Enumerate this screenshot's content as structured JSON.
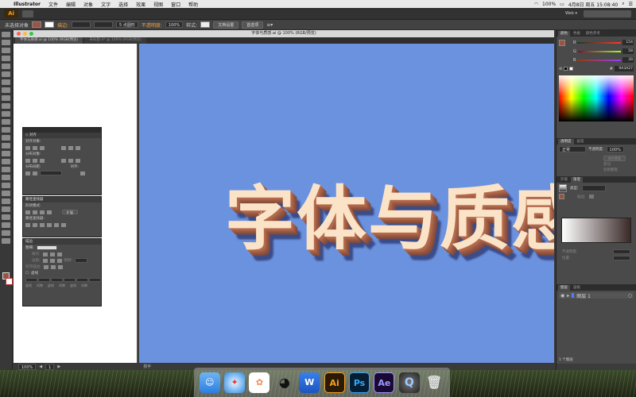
{
  "menubar": {
    "apple": "",
    "items": [
      "Illustrator",
      "文件",
      "编辑",
      "对象",
      "文字",
      "选择",
      "效果",
      "视图",
      "窗口",
      "帮助"
    ],
    "battery": "100%",
    "clock": "4月8日 周五 15:08:40"
  },
  "appbar": {
    "logo": "Ai",
    "workspace": "Web ▾"
  },
  "controlbar": {
    "selection_label": "未选择对象",
    "stroke_label": "描边:",
    "brush_value": "5 点圆形",
    "opacity_label": "不透明度:",
    "opacity_value": "100%",
    "style_label": "样式:",
    "doc_setup": "文档设置",
    "preferences": "首选项"
  },
  "document": {
    "title": "字体与质感.ai @ 100% (RGB/预览)",
    "tabs": [
      "字体与质感.ai @ 100% (RGB/预览)",
      "未标题-3* @ 100% (RGB/预览)"
    ],
    "headline": "字体与质感",
    "zoom": "100%",
    "page": "1",
    "status_tool": "抓手"
  },
  "align_panel": {
    "align_objects": "对齐对象:",
    "distribute_objects": "分布对象:",
    "distribute_spacing": "分布间距:",
    "align_to": "对齐:"
  },
  "pathfinder_panel": {
    "shape_modes": "形状模式:",
    "pathfinders": "路径查找器:",
    "expand": "扩展"
  },
  "stroke_panel": {
    "title": "描边",
    "weight_label": "粗细:",
    "cap_label": "端点:",
    "corner_label": "边角:",
    "limit_label": "限制:",
    "align_label": "对齐描边:",
    "dashed": "虚线",
    "dash_labels": [
      "虚线",
      "间隙",
      "虚线",
      "间隙",
      "虚线",
      "间隙"
    ]
  },
  "color_panel": {
    "tabs": [
      "颜色",
      "色板",
      "颜色参考"
    ],
    "r_label": "R",
    "g_label": "G",
    "b_label": "B",
    "r": "154",
    "g": "58",
    "b": "39",
    "hex": "9A3A27"
  },
  "transparency_panel": {
    "tabs": [
      "透明度",
      "画笔"
    ],
    "mode": "正常",
    "opacity_label": "不透明度:",
    "opacity": "100%",
    "make_mask": "制作蒙版",
    "clip": "剪切",
    "invert_mask": "反相蒙版"
  },
  "gradient_panel": {
    "tabs": [
      "外观",
      "渐变"
    ],
    "type_label": "类型:",
    "stroke_label": "描边:",
    "opacity_label": "不透明度:",
    "location_label": "位置:"
  },
  "layers_panel": {
    "tabs": [
      "图层",
      "画板"
    ],
    "layer_name": "图层 1",
    "footer": "1 个图层"
  },
  "colors": {
    "artboard": "#6b92de",
    "headline_face": "#fbe3c7",
    "fill": "#9a5443"
  }
}
